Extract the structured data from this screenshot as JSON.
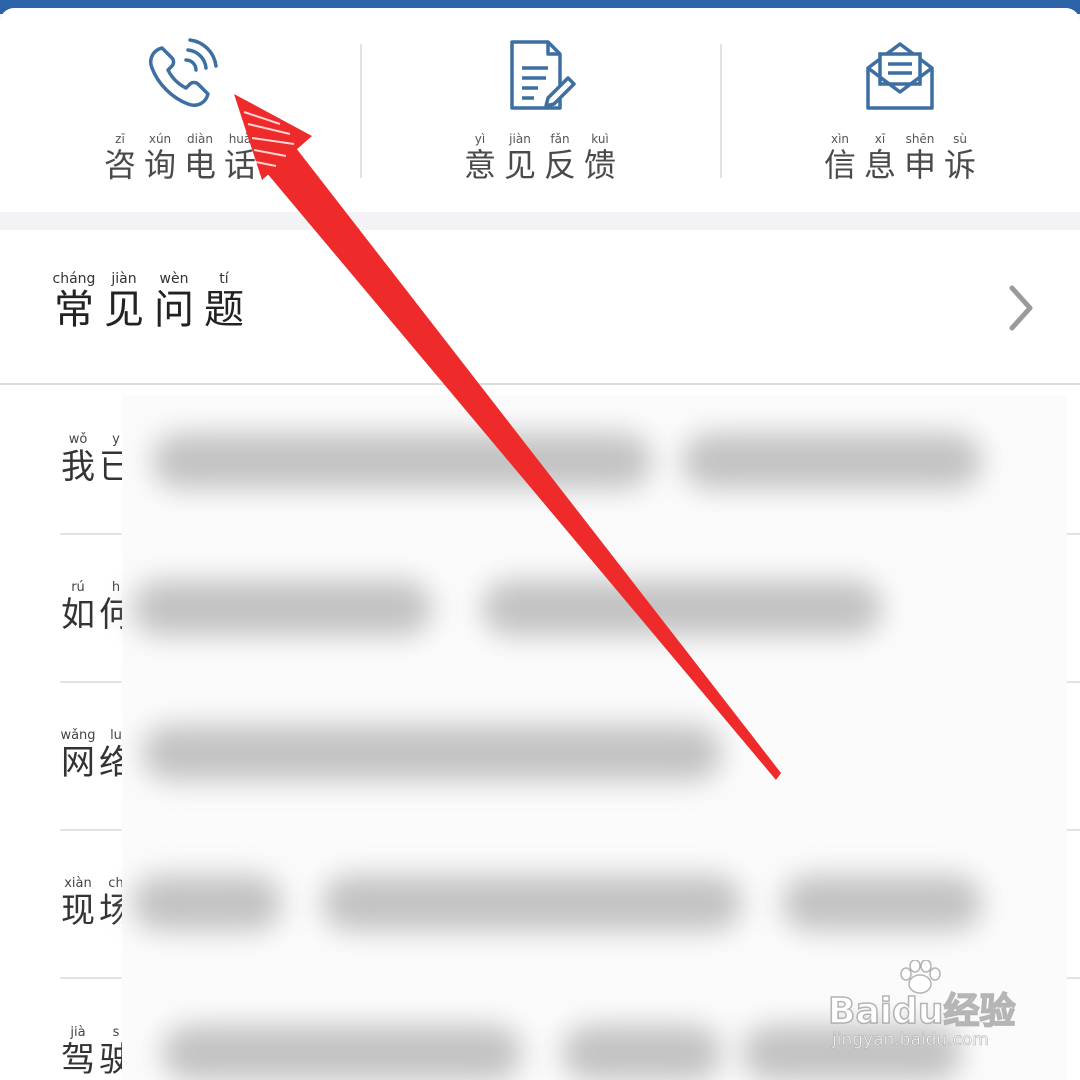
{
  "services": [
    {
      "id": "phone",
      "icon": "phone-icon",
      "chars": [
        "咨",
        "询",
        "电",
        "话"
      ],
      "pinyin": [
        "zī",
        "xún",
        "diàn",
        "huà"
      ]
    },
    {
      "id": "feedback",
      "icon": "document-edit-icon",
      "chars": [
        "意",
        "见",
        "反",
        "馈"
      ],
      "pinyin": [
        "yì",
        "jiàn",
        "fǎn",
        "kuì"
      ]
    },
    {
      "id": "complaint",
      "icon": "envelope-icon",
      "chars": [
        "信",
        "息",
        "申",
        "诉"
      ],
      "pinyin": [
        "xìn",
        "xī",
        "shēn",
        "sù"
      ]
    }
  ],
  "faq": {
    "title_chars": [
      "常",
      "见",
      "问",
      "题"
    ],
    "title_pinyin": [
      "cháng",
      "jiàn",
      "wèn",
      "tí"
    ],
    "items": [
      {
        "chars": [
          "我",
          "已"
        ],
        "pinyin": [
          "wǒ",
          "y"
        ]
      },
      {
        "chars": [
          "如",
          "何"
        ],
        "pinyin": [
          "rú",
          "h"
        ]
      },
      {
        "chars": [
          "网",
          "络"
        ],
        "pinyin": [
          "wǎng",
          "lu"
        ]
      },
      {
        "chars": [
          "现",
          "场"
        ],
        "pinyin": [
          "xiàn",
          "ch"
        ]
      },
      {
        "chars": [
          "驾",
          "驶"
        ],
        "pinyin": [
          "jià",
          "s"
        ]
      }
    ]
  },
  "watermark": {
    "logo": "Baidu经验",
    "url": "jingyan.baidu.com"
  },
  "colors": {
    "accent": "#2a63a8",
    "arrow": "#ee2a2a",
    "icon": "#3d6fa3"
  }
}
